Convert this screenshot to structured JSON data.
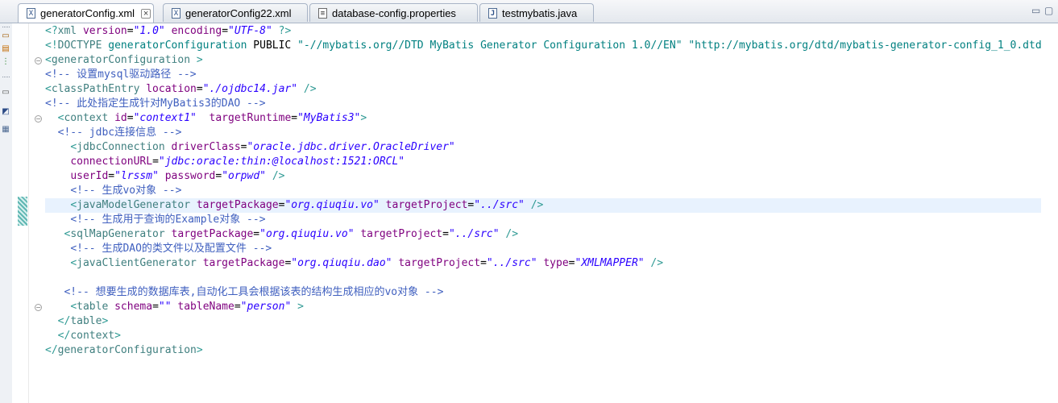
{
  "tabs": [
    {
      "label": "generatorConfig.xml",
      "icon": "xml-file-icon",
      "active": true,
      "close": "×"
    },
    {
      "label": "generatorConfig22.xml",
      "icon": "xml-file-icon",
      "active": false
    },
    {
      "label": "database-config.properties",
      "icon": "properties-file-icon",
      "active": false
    },
    {
      "label": "testmybatis.java",
      "icon": "java-file-icon",
      "active": false
    }
  ],
  "icons": {
    "xml_glyph": "X",
    "props_glyph": "≡",
    "java_glyph": "J",
    "minimize": "▭",
    "maximize": "▢"
  },
  "colors": {
    "tag": "#3f7f7f",
    "attribute": "#7f007f",
    "value": "#2a00ff",
    "comment": "#3f5fbf",
    "punctuation": "#2f9a94",
    "current_line": "#e8f2fe"
  },
  "code_lines": [
    [
      [
        "punc",
        "<?"
      ],
      [
        "tag",
        "xml"
      ],
      [
        "plain",
        " "
      ],
      [
        "attr",
        "version"
      ],
      [
        "plain",
        "="
      ],
      [
        "val",
        "\"1.0\""
      ],
      [
        "plain",
        " "
      ],
      [
        "attr",
        "encoding"
      ],
      [
        "plain",
        "="
      ],
      [
        "val",
        "\"UTF-8\""
      ],
      [
        "plain",
        " "
      ],
      [
        "punc",
        "?>"
      ]
    ],
    [
      [
        "punc",
        "<!"
      ],
      [
        "tag",
        "DOCTYPE"
      ],
      [
        "plain",
        " "
      ],
      [
        "decl",
        "generatorConfiguration"
      ],
      [
        "plain",
        " PUBLIC "
      ],
      [
        "decl",
        "\"-//mybatis.org//DTD MyBatis Generator Configuration 1.0//EN\""
      ],
      [
        "plain",
        " "
      ],
      [
        "decl",
        "\"http://mybatis.org/dtd/mybatis-generator-config_1_0.dtd\""
      ],
      [
        "punc",
        ">"
      ]
    ],
    [
      [
        "punc",
        "<"
      ],
      [
        "tag",
        "generatorConfiguration"
      ],
      [
        "plain",
        " "
      ],
      [
        "punc",
        ">"
      ]
    ],
    [
      [
        "comment",
        "<!-- 设置mysql驱动路径 -->"
      ]
    ],
    [
      [
        "punc",
        "<"
      ],
      [
        "tag",
        "classPathEntry"
      ],
      [
        "plain",
        " "
      ],
      [
        "attr",
        "location"
      ],
      [
        "plain",
        "="
      ],
      [
        "val",
        "\"./ojdbc14.jar\""
      ],
      [
        "plain",
        " "
      ],
      [
        "punc",
        "/>"
      ]
    ],
    [
      [
        "comment",
        "<!-- 此处指定生成针对MyBatis3的DAO -->"
      ]
    ],
    [
      [
        "plain",
        "  "
      ],
      [
        "punc",
        "<"
      ],
      [
        "tag",
        "context"
      ],
      [
        "plain",
        " "
      ],
      [
        "attr",
        "id"
      ],
      [
        "plain",
        "="
      ],
      [
        "val",
        "\"context1\""
      ],
      [
        "plain",
        "  "
      ],
      [
        "attr",
        "targetRuntime"
      ],
      [
        "plain",
        "="
      ],
      [
        "val",
        "\"MyBatis3\""
      ],
      [
        "punc",
        ">"
      ]
    ],
    [
      [
        "plain",
        "  "
      ],
      [
        "comment",
        "<!-- jdbc连接信息 -->"
      ]
    ],
    [
      [
        "plain",
        "    "
      ],
      [
        "punc",
        "<"
      ],
      [
        "tag",
        "jdbcConnection"
      ],
      [
        "plain",
        " "
      ],
      [
        "attr",
        "driverClass"
      ],
      [
        "plain",
        "="
      ],
      [
        "val",
        "\"oracle.jdbc.driver.OracleDriver\""
      ]
    ],
    [
      [
        "plain",
        "    "
      ],
      [
        "attr",
        "connectionURL"
      ],
      [
        "plain",
        "="
      ],
      [
        "val",
        "\"jdbc:oracle:thin:@localhost:1521:ORCL\""
      ]
    ],
    [
      [
        "plain",
        "    "
      ],
      [
        "attr",
        "userId"
      ],
      [
        "plain",
        "="
      ],
      [
        "val",
        "\"lrssm\""
      ],
      [
        "plain",
        " "
      ],
      [
        "attr",
        "password"
      ],
      [
        "plain",
        "="
      ],
      [
        "val",
        "\"orpwd\""
      ],
      [
        "plain",
        " "
      ],
      [
        "punc",
        "/>"
      ]
    ],
    [
      [
        "plain",
        "    "
      ],
      [
        "comment",
        "<!-- 生成vo对象 -->"
      ]
    ],
    [
      [
        "plain",
        "    "
      ],
      [
        "punc",
        "<"
      ],
      [
        "tag",
        "javaModelGenerator"
      ],
      [
        "plain",
        " "
      ],
      [
        "attr",
        "targetPackage"
      ],
      [
        "plain",
        "="
      ],
      [
        "val",
        "\"org.qiuqiu.vo\""
      ],
      [
        "plain",
        " "
      ],
      [
        "attr",
        "targetProject"
      ],
      [
        "plain",
        "="
      ],
      [
        "val",
        "\"../src\""
      ],
      [
        "plain",
        " "
      ],
      [
        "punc",
        "/>"
      ]
    ],
    [
      [
        "plain",
        "    "
      ],
      [
        "comment",
        "<!-- 生成用于查询的Example对象 -->"
      ]
    ],
    [
      [
        "plain",
        "   "
      ],
      [
        "punc",
        "<"
      ],
      [
        "tag",
        "sqlMapGenerator"
      ],
      [
        "plain",
        " "
      ],
      [
        "attr",
        "targetPackage"
      ],
      [
        "plain",
        "="
      ],
      [
        "val",
        "\"org.qiuqiu.vo\""
      ],
      [
        "plain",
        " "
      ],
      [
        "attr",
        "targetProject"
      ],
      [
        "plain",
        "="
      ],
      [
        "val",
        "\"../src\""
      ],
      [
        "plain",
        " "
      ],
      [
        "punc",
        "/>"
      ]
    ],
    [
      [
        "plain",
        "    "
      ],
      [
        "comment",
        "<!-- 生成DAO的类文件以及配置文件 -->"
      ]
    ],
    [
      [
        "plain",
        "    "
      ],
      [
        "punc",
        "<"
      ],
      [
        "tag",
        "javaClientGenerator"
      ],
      [
        "plain",
        " "
      ],
      [
        "attr",
        "targetPackage"
      ],
      [
        "plain",
        "="
      ],
      [
        "val",
        "\"org.qiuqiu.dao\""
      ],
      [
        "plain",
        " "
      ],
      [
        "attr",
        "targetProject"
      ],
      [
        "plain",
        "="
      ],
      [
        "val",
        "\"../src\""
      ],
      [
        "plain",
        " "
      ],
      [
        "attr",
        "type"
      ],
      [
        "plain",
        "="
      ],
      [
        "val",
        "\"XMLMAPPER\""
      ],
      [
        "plain",
        " "
      ],
      [
        "punc",
        "/>"
      ]
    ],
    [
      [
        "plain",
        ""
      ]
    ],
    [
      [
        "plain",
        "   "
      ],
      [
        "comment",
        "<!-- 想要生成的数据库表,自动化工具会根据该表的结构生成相应的vo对象 -->"
      ]
    ],
    [
      [
        "plain",
        "    "
      ],
      [
        "punc",
        "<"
      ],
      [
        "tag",
        "table"
      ],
      [
        "plain",
        " "
      ],
      [
        "attr",
        "schema"
      ],
      [
        "plain",
        "="
      ],
      [
        "val",
        "\"\""
      ],
      [
        "plain",
        " "
      ],
      [
        "attr",
        "tableName"
      ],
      [
        "plain",
        "="
      ],
      [
        "val",
        "\"person\""
      ],
      [
        "plain",
        " "
      ],
      [
        "punc",
        ">"
      ]
    ],
    [
      [
        "plain",
        "  "
      ],
      [
        "punc",
        "</"
      ],
      [
        "tag",
        "table"
      ],
      [
        "punc",
        ">"
      ]
    ],
    [
      [
        "plain",
        "  "
      ],
      [
        "punc",
        "</"
      ],
      [
        "tag",
        "context"
      ],
      [
        "punc",
        ">"
      ]
    ],
    [
      [
        "punc",
        "</"
      ],
      [
        "tag",
        "generatorConfiguration"
      ],
      [
        "punc",
        ">"
      ]
    ]
  ],
  "current_line": 12,
  "fold_markers": [
    {
      "line": 2,
      "glyph": "⊖"
    },
    {
      "line": 6,
      "glyph": "⊖"
    },
    {
      "line": 19,
      "glyph": "⊖"
    }
  ]
}
